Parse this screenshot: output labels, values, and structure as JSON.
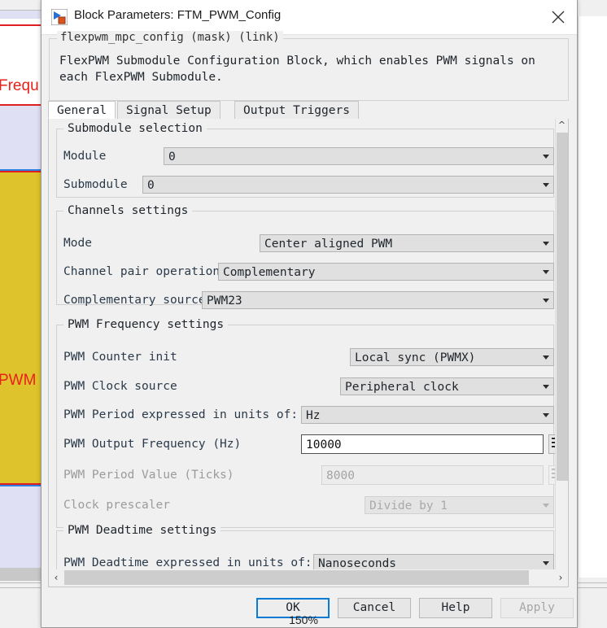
{
  "canvas": {
    "label_frequency": "Frequ",
    "label_pwm": "PWM",
    "zoom_level": "150%"
  },
  "dialog": {
    "title": "Block Parameters: FTM_PWM_Config",
    "icon": "simulink-block-icon",
    "close_icon": "close-icon",
    "mask": {
      "title": "flexpwm_mpc_config (mask) (link)",
      "description": "FlexPWM Submodule Configuration Block, which enables PWM signals on each FlexPWM Submodule."
    },
    "tabs": [
      {
        "label": "General",
        "selected": true
      },
      {
        "label": "Signal Setup",
        "selected": false
      },
      {
        "label": "Output Triggers",
        "selected": false
      }
    ],
    "groups": [
      {
        "title": "Submodule selection",
        "fields": [
          {
            "label": "Module",
            "value": "0",
            "type": "combo",
            "enabled": true
          },
          {
            "label": "Submodule",
            "value": "0",
            "type": "combo",
            "enabled": true
          }
        ]
      },
      {
        "title": "Channels settings",
        "fields": [
          {
            "label": "Mode",
            "value": "Center aligned PWM",
            "type": "combo",
            "enabled": true
          },
          {
            "label": "Channel pair operation",
            "value": "Complementary",
            "type": "combo",
            "enabled": true
          },
          {
            "label": "Complementary source",
            "value": "PWM23",
            "type": "combo",
            "enabled": true
          }
        ]
      },
      {
        "title": "PWM Frequency settings",
        "fields": [
          {
            "label": "PWM Counter init",
            "value": "Local sync (PWMX)",
            "type": "combo",
            "enabled": true
          },
          {
            "label": "PWM Clock source",
            "value": "Peripheral clock",
            "type": "combo",
            "enabled": true
          },
          {
            "label": "PWM Period expressed in units of:",
            "value": "Hz",
            "type": "combo",
            "enabled": true
          },
          {
            "label": "PWM Output Frequency (Hz)",
            "value": "10000",
            "type": "text",
            "enabled": true
          },
          {
            "label": "PWM Period Value (Ticks)",
            "value": "8000",
            "type": "text",
            "enabled": false
          },
          {
            "label": "Clock prescaler",
            "value": "Divide by 1",
            "type": "combo",
            "enabled": false
          }
        ]
      },
      {
        "title": "PWM Deadtime settings",
        "fields": [
          {
            "label": "PWM Deadtime expressed in units of:",
            "value": "Nanoseconds",
            "type": "combo",
            "enabled": true
          }
        ]
      }
    ],
    "scrollbars": {
      "vertical_up": "^",
      "vertical_down": "∨",
      "horizontal_left": "‹",
      "horizontal_right": "›"
    },
    "buttons": [
      {
        "label": "OK",
        "style": "default"
      },
      {
        "label": "Cancel",
        "style": "normal"
      },
      {
        "label": "Help",
        "style": "normal"
      },
      {
        "label": "Apply",
        "style": "disabled"
      }
    ]
  }
}
